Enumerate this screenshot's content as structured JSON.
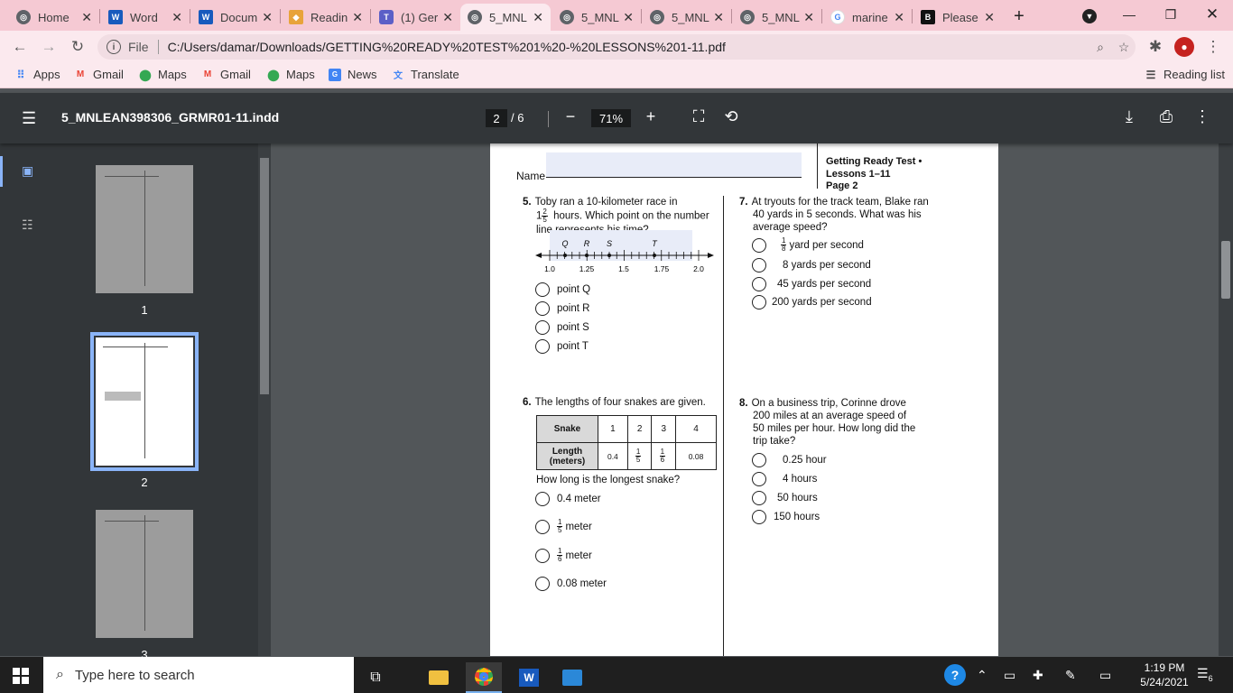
{
  "tabs": [
    {
      "label": "Home",
      "icon": "chrome-globe-icon",
      "color": "#5f6368"
    },
    {
      "label": "Word",
      "icon": "word-icon",
      "color": "#185abd"
    },
    {
      "label": "Docum",
      "icon": "word-icon",
      "color": "#185abd"
    },
    {
      "label": "Readin",
      "icon": "cube-icon",
      "color": "#e8a33a"
    },
    {
      "label": "(1) Ger",
      "icon": "teams-icon",
      "color": "#5b5fc7"
    },
    {
      "label": "5_MNL",
      "icon": "chrome-globe-icon",
      "color": "#5f6368"
    },
    {
      "label": "5_MNL",
      "icon": "chrome-globe-icon",
      "color": "#5f6368"
    },
    {
      "label": "5_MNL",
      "icon": "chrome-globe-icon",
      "color": "#5f6368"
    },
    {
      "label": "5_MNL",
      "icon": "chrome-globe-icon",
      "color": "#5f6368"
    },
    {
      "label": "marine",
      "icon": "google-icon",
      "color": "#4285f4"
    },
    {
      "label": "Please",
      "icon": "brainly-icon",
      "color": "#111111"
    }
  ],
  "address": {
    "scheme_label": "File",
    "url": "C:/Users/damar/Downloads/GETTING%20READY%20TEST%201%20-%20LESSONS%201-11.pdf"
  },
  "bookmarks": [
    {
      "label": "Apps",
      "icon": "apps-grid-icon"
    },
    {
      "label": "Gmail",
      "icon": "gmail-icon"
    },
    {
      "label": "Maps",
      "icon": "maps-pin-icon"
    },
    {
      "label": "Gmail",
      "icon": "gmail-icon"
    },
    {
      "label": "Maps",
      "icon": "maps-pin-icon"
    },
    {
      "label": "News",
      "icon": "news-icon"
    },
    {
      "label": "Translate",
      "icon": "translate-icon"
    }
  ],
  "reading_list": "Reading list",
  "pdf": {
    "title": "5_MNLEAN398306_GRMR01-11.indd",
    "page_current": "2",
    "page_total": "/  6",
    "zoom": "71%"
  },
  "thumbnails": [
    "1",
    "2",
    "3"
  ],
  "doc": {
    "name_label": "Name",
    "header_lines": [
      "Getting Ready Test •",
      "Lessons 1–11",
      "Page 2"
    ],
    "q5": {
      "num": "5.",
      "text_a": "Toby ran a 10-kilometer race in",
      "whole": "1",
      "frac_num": "2",
      "frac_den": "5",
      "text_b": "hours. Which point on the number",
      "text_c": "line represents his time?",
      "point_labels": [
        "Q",
        "R",
        "S",
        "T"
      ],
      "tick_labels": [
        "1.0",
        "1.25",
        "1.5",
        "1.75",
        "2.0"
      ],
      "options": [
        "point Q",
        "point R",
        "point S",
        "point T"
      ]
    },
    "q6": {
      "num": "6.",
      "text": "The lengths of four snakes are given.",
      "col_header": "Snake",
      "row_header_a": "Length",
      "row_header_b": "(meters)",
      "snakes": [
        "1",
        "2",
        "3",
        "4"
      ],
      "len_1": "0.4",
      "len_2_num": "1",
      "len_2_den": "5",
      "len_3_num": "1",
      "len_3_den": "6",
      "len_4": "0.08",
      "ask": "How long is the longest snake?",
      "opt_a": "0.4 meter",
      "opt_b_num": "1",
      "opt_b_den": "5",
      "opt_b_unit": "meter",
      "opt_c_num": "1",
      "opt_c_den": "6",
      "opt_c_unit": "meter",
      "opt_d": "0.08 meter"
    },
    "q7": {
      "num": "7.",
      "lines": [
        "At tryouts for the track team, Blake ran",
        "40 yards in 5 seconds. What was his",
        "average speed?"
      ],
      "opt_a_num": "1",
      "opt_a_den": "8",
      "opt_a_unit": "yard per second",
      "opt_b": "8 yards per second",
      "opt_c": "45 yards per second",
      "opt_d": "200 yards per second"
    },
    "q8": {
      "num": "8.",
      "lines": [
        "On a business trip, Corinne drove",
        "200 miles at an average speed of",
        "50 miles per hour. How long did the",
        "trip take?"
      ],
      "options": [
        "0.25 hour",
        "4 hours",
        "50 hours",
        "150 hours"
      ]
    }
  },
  "taskbar": {
    "search_placeholder": "Type here to search",
    "time": "1:19 PM",
    "date": "5/24/2021",
    "notif_count": "6"
  }
}
